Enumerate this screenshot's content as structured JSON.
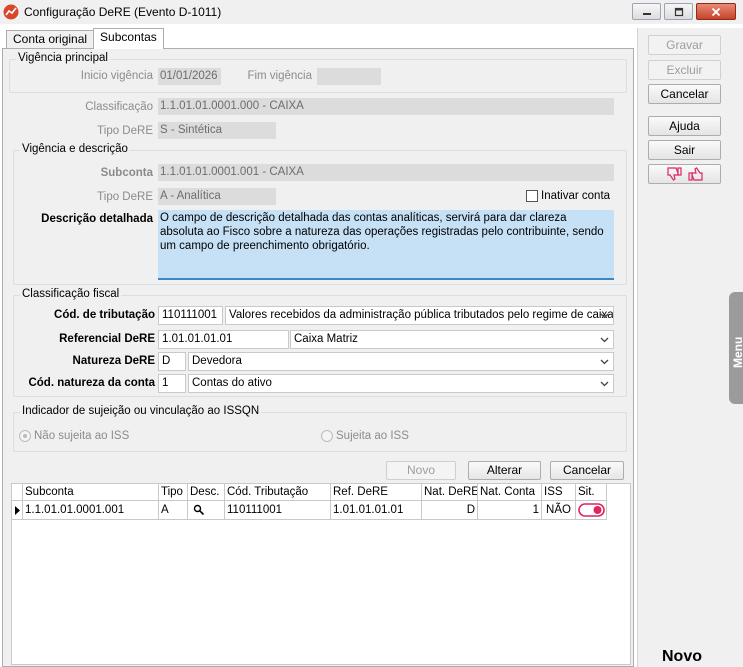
{
  "window": {
    "title": "Configuração DeRE (Evento D-1011)"
  },
  "tabs": [
    {
      "label": "Conta original"
    },
    {
      "label": "Subcontas"
    }
  ],
  "vigencia_principal": {
    "title": "Vigência principal",
    "inicio_label": "Inicio vigência",
    "inicio_value": "01/01/2026",
    "fim_label": "Fim vigência",
    "fim_value": ""
  },
  "classificacao": {
    "label": "Classificação",
    "value": "1.1.01.01.0001.000 - CAIXA"
  },
  "tipo_dere_principal": {
    "label": "Tipo DeRE",
    "value": "S - Sintética"
  },
  "vigencia_descricao": {
    "title": "Vigência e descrição",
    "subconta_label": "Subconta",
    "subconta_value": "1.1.01.01.0001.001 - CAIXA",
    "tipo_label": "Tipo DeRE",
    "tipo_value": "A - Analítica",
    "inativar_label": "Inativar conta",
    "descricao_label": "Descrição detalhada",
    "descricao_value": "O campo de descrição detalhada das contas analíticas, servirá para dar clareza absoluta ao Fisco sobre a natureza das operações registradas pelo contribuinte, sendo um campo de preenchimento obrigatório."
  },
  "classificacao_fiscal": {
    "title": "Classificação fiscal",
    "cod_tributacao_label": "Cód. de tributação",
    "cod_tributacao_code": "110111001",
    "cod_tributacao_desc": "Valores recebidos da administração pública tributados pelo regime de caixa",
    "referencial_label": "Referencial DeRE",
    "referencial_code": "1.01.01.01.01",
    "referencial_desc": "Caixa Matriz",
    "natureza_label": "Natureza DeRE",
    "natureza_code": "D",
    "natureza_desc": "Devedora",
    "cod_natureza_label": "Cód. natureza da conta",
    "cod_natureza_code": "1",
    "cod_natureza_desc": "Contas do ativo"
  },
  "issqn": {
    "title": "Indicador de sujeição ou vinculação ao ISSQN",
    "option1": "Não sujeita ao ISS",
    "option2": "Sujeita ao ISS"
  },
  "grid_buttons": {
    "novo": "Novo",
    "alterar": "Alterar",
    "cancelar": "Cancelar"
  },
  "grid": {
    "headers": [
      "Subconta",
      "Tipo",
      "Desc.",
      "Cód. Tributação",
      "Ref. DeRE",
      "Nat. DeRE",
      "Nat. Conta",
      "ISS",
      "Sit."
    ],
    "rows": [
      {
        "subconta": "1.1.01.01.0001.001",
        "tipo": "A",
        "cod_trib": "110111001",
        "ref": "1.01.01.01.01",
        "nat_dere": "D",
        "nat_conta": "1",
        "iss": "NÃO"
      }
    ]
  },
  "sidebar": {
    "gravar": "Gravar",
    "excluir": "Excluir",
    "cancelar": "Cancelar",
    "ajuda": "Ajuda",
    "sair": "Sair",
    "menu": "Menu",
    "novo": "Novo"
  },
  "colors": {
    "accent_toggle": "#e0245e",
    "desc_bg": "#c6e0f5",
    "desc_border": "#3c87c9"
  }
}
